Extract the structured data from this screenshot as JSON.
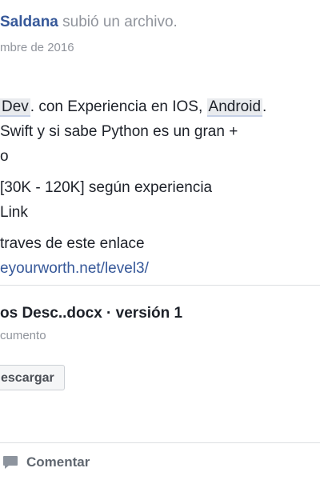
{
  "post": {
    "author": "Saldana",
    "action": " subió un archivo.",
    "timestamp": "mbre de 2016"
  },
  "body": {
    "line1_tag1": "Dev",
    "line1_text1": ". con Experiencia en IOS, ",
    "line1_tag2": "Android",
    "line1_text2": ".",
    "line2": " Swift y si sabe Python es un gran +",
    "line3": "o",
    "line4": " [30K - 120K] según experiencia",
    "line5": "Link",
    "line6": "traves de este enlace",
    "link": "eyourworth.net/level3/"
  },
  "file": {
    "title": "os Desc..docx · versión 1",
    "type": "cumento",
    "download_label": "escargar"
  },
  "actions": {
    "comment_label": "Comentar",
    "comment_icon": "comment-bubble-icon"
  },
  "colors": {
    "link": "#365899",
    "meta": "#90949c",
    "tag_bg": "#e9ebee"
  }
}
